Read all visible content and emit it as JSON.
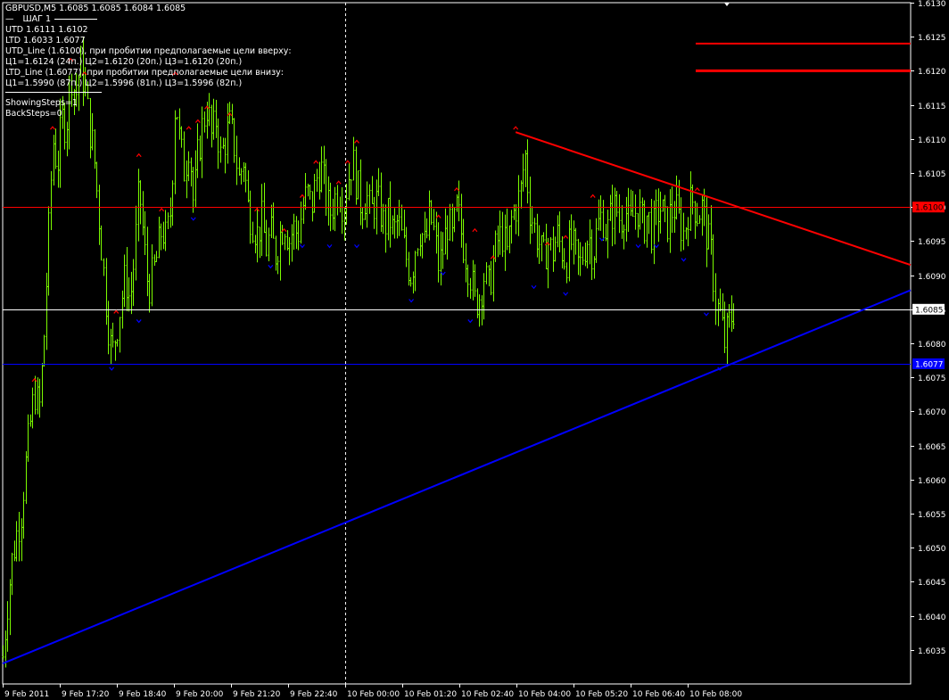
{
  "header": {
    "symbol_line": "GBPUSD,M5  1.6085 1.6085 1.6084 1.6085",
    "step_label": "ШАГ 1",
    "utd": "UTD  1.6111  1.6102",
    "ltd": "LTD  1.6033  1.6077",
    "utd_line": "UTD_Line (1.6100), при пробитии предполагаемые цели вверху:",
    "utd_targets": "Ц1=1.6124 (24п.) Ц2=1.6120 (20п.) Ц3=1.6120 (20п.)",
    "ltd_line": "LTD_Line (1.6077), при пробитии предполагаемые цели внизу:",
    "ltd_targets": "Ц1=1.5990 (87п.) Ц2=1.5996 (81п.) Ц3=1.5996 (82п.)",
    "showing_steps": "ShowingSteps=1",
    "back_steps": "BackSteps=0"
  },
  "colors": {
    "background": "#000000",
    "candle": "#7CFC00",
    "utd_line": "#FF0000",
    "ltd_line": "#0000FF",
    "grid": "#FFFFFF",
    "axis_text": "#FFFFFF",
    "bid_line": "#FFFFFF",
    "fractal_up": "#FF0000",
    "fractal_down": "#0000FF"
  },
  "chart_data": {
    "type": "candlestick",
    "symbol": "GBPUSD",
    "timeframe": "M5",
    "ylim": [
      1.603,
      1.613
    ],
    "y_ticks": [
      "1.6130",
      "1.6125",
      "1.6120",
      "1.6115",
      "1.6110",
      "1.6105",
      "1.6100",
      "1.6095",
      "1.6090",
      "1.6085",
      "1.6080",
      "1.6075",
      "1.6070",
      "1.6065",
      "1.6060",
      "1.6055",
      "1.6050",
      "1.6045",
      "1.6040",
      "1.6035"
    ],
    "x_ticks": [
      "9 Feb 2011",
      "9 Feb 17:20",
      "9 Feb 18:40",
      "9 Feb 20:00",
      "9 Feb 21:20",
      "9 Feb 22:40",
      "10 Feb 00:00",
      "10 Feb 01:20",
      "10 Feb 02:40",
      "10 Feb 04:00",
      "10 Feb 05:20",
      "10 Feb 06:40",
      "10 Feb 08:00"
    ],
    "price_labels": {
      "utd_level": "1.6100",
      "bid": "1.6085",
      "ltd_level": "1.6077"
    },
    "levels": {
      "utd_level": 1.61,
      "bid": 1.6085,
      "ltd_level": 1.6077,
      "target_1": 1.6124,
      "target_2": 1.612
    },
    "session_separator_index": 6,
    "trend_lines": [
      {
        "name": "UTD_Line",
        "from": [
          0.565,
          1.6111
        ],
        "to": [
          1.0,
          1.60915
        ]
      },
      {
        "name": "LTD_Line",
        "from": [
          0.0,
          1.6033
        ],
        "to": [
          1.0,
          1.60878
        ]
      }
    ],
    "price_path": [
      [
        0.0,
        1.6034
      ],
      [
        0.005,
        1.6042
      ],
      [
        0.01,
        1.6048
      ],
      [
        0.015,
        1.6052
      ],
      [
        0.02,
        1.6055
      ],
      [
        0.025,
        1.6062
      ],
      [
        0.03,
        1.6068
      ],
      [
        0.035,
        1.6073
      ],
      [
        0.04,
        1.607
      ],
      [
        0.045,
        1.608
      ],
      [
        0.05,
        1.6095
      ],
      [
        0.055,
        1.611
      ],
      [
        0.06,
        1.6106
      ],
      [
        0.065,
        1.6113
      ],
      [
        0.07,
        1.6112
      ],
      [
        0.075,
        1.612
      ],
      [
        0.08,
        1.6116
      ],
      [
        0.085,
        1.6121
      ],
      [
        0.09,
        1.6118
      ],
      [
        0.095,
        1.6112
      ],
      [
        0.1,
        1.6108
      ],
      [
        0.105,
        1.61
      ],
      [
        0.11,
        1.6092
      ],
      [
        0.115,
        1.6084
      ],
      [
        0.12,
        1.6078
      ],
      [
        0.125,
        1.6082
      ],
      [
        0.13,
        1.6086
      ],
      [
        0.135,
        1.609
      ],
      [
        0.14,
        1.6086
      ],
      [
        0.145,
        1.6093
      ],
      [
        0.15,
        1.6103
      ],
      [
        0.155,
        1.6095
      ],
      [
        0.16,
        1.6088
      ],
      [
        0.165,
        1.609
      ],
      [
        0.17,
        1.6093
      ],
      [
        0.175,
        1.6097
      ],
      [
        0.18,
        1.6095
      ],
      [
        0.185,
        1.61
      ],
      [
        0.19,
        1.6117
      ],
      [
        0.195,
        1.6109
      ],
      [
        0.2,
        1.6105
      ],
      [
        0.205,
        1.611
      ],
      [
        0.21,
        1.61
      ],
      [
        0.215,
        1.6108
      ],
      [
        0.22,
        1.6112
      ],
      [
        0.225,
        1.6115
      ],
      [
        0.23,
        1.611
      ],
      [
        0.235,
        1.6113
      ],
      [
        0.24,
        1.6107
      ],
      [
        0.245,
        1.611
      ],
      [
        0.25,
        1.6112
      ],
      [
        0.255,
        1.6109
      ],
      [
        0.26,
        1.6104
      ],
      [
        0.265,
        1.6107
      ],
      [
        0.27,
        1.61
      ],
      [
        0.275,
        1.6098
      ],
      [
        0.28,
        1.6096
      ],
      [
        0.285,
        1.6098
      ],
      [
        0.29,
        1.6094
      ],
      [
        0.295,
        1.6096
      ],
      [
        0.3,
        1.6093
      ],
      [
        0.305,
        1.6096
      ],
      [
        0.31,
        1.6098
      ],
      [
        0.315,
        1.6095
      ],
      [
        0.32,
        1.6097
      ],
      [
        0.325,
        1.6096
      ],
      [
        0.33,
        1.61
      ],
      [
        0.335,
        1.6102
      ],
      [
        0.34,
        1.61
      ],
      [
        0.345,
        1.6104
      ],
      [
        0.35,
        1.6106
      ],
      [
        0.355,
        1.6102
      ],
      [
        0.36,
        1.6099
      ],
      [
        0.365,
        1.6101
      ],
      [
        0.37,
        1.6103
      ],
      [
        0.375,
        1.61
      ],
      [
        0.38,
        1.6104
      ],
      [
        0.385,
        1.6107
      ],
      [
        0.39,
        1.6103
      ],
      [
        0.395,
        1.61
      ],
      [
        0.4,
        1.6102
      ],
      [
        0.405,
        1.6099
      ],
      [
        0.41,
        1.6101
      ],
      [
        0.415,
        1.61
      ],
      [
        0.42,
        1.6097
      ],
      [
        0.425,
        1.6099
      ],
      [
        0.43,
        1.6096
      ],
      [
        0.435,
        1.6098
      ],
      [
        0.44,
        1.6095
      ],
      [
        0.445,
        1.6092
      ],
      [
        0.45,
        1.609
      ],
      [
        0.455,
        1.6095
      ],
      [
        0.46,
        1.6097
      ],
      [
        0.465,
        1.6094
      ],
      [
        0.47,
        1.6099
      ],
      [
        0.475,
        1.6096
      ],
      [
        0.48,
        1.6091
      ],
      [
        0.485,
        1.6094
      ],
      [
        0.49,
        1.6098
      ],
      [
        0.495,
        1.6095
      ],
      [
        0.5,
        1.61
      ],
      [
        0.505,
        1.6096
      ],
      [
        0.51,
        1.6093
      ],
      [
        0.515,
        1.609
      ],
      [
        0.52,
        1.6086
      ],
      [
        0.525,
        1.6087
      ],
      [
        0.53,
        1.609
      ],
      [
        0.535,
        1.6088
      ],
      [
        0.54,
        1.6092
      ],
      [
        0.545,
        1.6095
      ],
      [
        0.55,
        1.6096
      ],
      [
        0.555,
        1.6093
      ],
      [
        0.56,
        1.6098
      ],
      [
        0.565,
        1.61
      ],
      [
        0.57,
        1.6102
      ],
      [
        0.575,
        1.6108
      ],
      [
        0.58,
        1.61
      ],
      [
        0.585,
        1.6097
      ],
      [
        0.59,
        1.6095
      ],
      [
        0.595,
        1.6092
      ],
      [
        0.6,
        1.6095
      ],
      [
        0.605,
        1.6093
      ],
      [
        0.61,
        1.6096
      ],
      [
        0.615,
        1.6094
      ],
      [
        0.62,
        1.6092
      ],
      [
        0.625,
        1.6095
      ],
      [
        0.63,
        1.6093
      ],
      [
        0.635,
        1.6091
      ],
      [
        0.64,
        1.6094
      ],
      [
        0.645,
        1.6096
      ],
      [
        0.65,
        1.6093
      ],
      [
        0.655,
        1.6097
      ],
      [
        0.66,
        1.6099
      ],
      [
        0.665,
        1.6096
      ],
      [
        0.67,
        1.6099
      ],
      [
        0.675,
        1.61
      ],
      [
        0.68,
        1.6098
      ],
      [
        0.685,
        1.61
      ],
      [
        0.69,
        1.6097
      ],
      [
        0.695,
        1.6099
      ],
      [
        0.7,
        1.61
      ],
      [
        0.705,
        1.6097
      ],
      [
        0.71,
        1.6099
      ],
      [
        0.715,
        1.6096
      ],
      [
        0.72,
        1.6099
      ],
      [
        0.725,
        1.61
      ],
      [
        0.73,
        1.6097
      ],
      [
        0.735,
        1.6099
      ],
      [
        0.74,
        1.61
      ],
      [
        0.745,
        1.6098
      ],
      [
        0.75,
        1.6096
      ],
      [
        0.755,
        1.61
      ],
      [
        0.76,
        1.6101
      ],
      [
        0.765,
        1.6099
      ],
      [
        0.77,
        1.61
      ],
      [
        0.775,
        1.6096
      ],
      [
        0.78,
        1.6093
      ],
      [
        0.785,
        1.6086
      ],
      [
        0.79,
        1.6084
      ],
      [
        0.795,
        1.608
      ],
      [
        0.8,
        1.6083
      ],
      [
        0.805,
        1.6085
      ]
    ],
    "fractals_up": [
      [
        0.035,
        1.6074
      ],
      [
        0.055,
        1.6111
      ],
      [
        0.075,
        1.6121
      ],
      [
        0.09,
        1.6119
      ],
      [
        0.125,
        1.6084
      ],
      [
        0.15,
        1.6107
      ],
      [
        0.175,
        1.6099
      ],
      [
        0.19,
        1.6119
      ],
      [
        0.205,
        1.6111
      ],
      [
        0.215,
        1.6112
      ],
      [
        0.225,
        1.6114
      ],
      [
        0.25,
        1.6113
      ],
      [
        0.28,
        1.6099
      ],
      [
        0.31,
        1.6096
      ],
      [
        0.33,
        1.6101
      ],
      [
        0.345,
        1.6106
      ],
      [
        0.37,
        1.6103
      ],
      [
        0.38,
        1.6106
      ],
      [
        0.39,
        1.6109
      ],
      [
        0.48,
        1.6098
      ],
      [
        0.5,
        1.6102
      ],
      [
        0.52,
        1.6096
      ],
      [
        0.54,
        1.6092
      ],
      [
        0.565,
        1.6111
      ],
      [
        0.6,
        1.6094
      ],
      [
        0.62,
        1.6095
      ],
      [
        0.65,
        1.6101
      ],
      [
        0.765,
        1.6102
      ]
    ],
    "fractals_down": [
      [
        0.12,
        1.6077
      ],
      [
        0.15,
        1.6084
      ],
      [
        0.21,
        1.6099
      ],
      [
        0.295,
        1.6092
      ],
      [
        0.33,
        1.6095
      ],
      [
        0.36,
        1.6095
      ],
      [
        0.39,
        1.6095
      ],
      [
        0.45,
        1.6087
      ],
      [
        0.485,
        1.6091
      ],
      [
        0.515,
        1.6084
      ],
      [
        0.585,
        1.6089
      ],
      [
        0.62,
        1.6088
      ],
      [
        0.66,
        1.6096
      ],
      [
        0.7,
        1.6095
      ],
      [
        0.72,
        1.6095
      ],
      [
        0.75,
        1.6093
      ],
      [
        0.775,
        1.6085
      ],
      [
        0.79,
        1.6077
      ]
    ]
  }
}
